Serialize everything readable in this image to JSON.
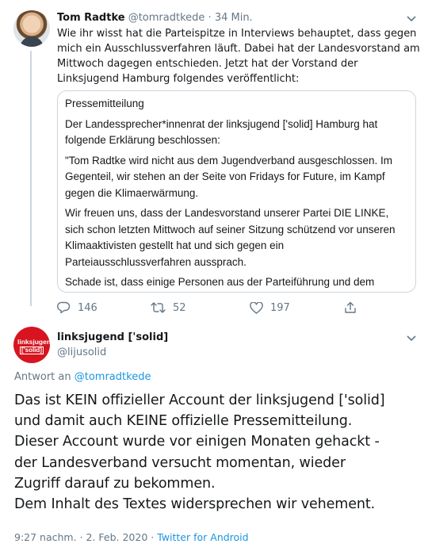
{
  "tweet1": {
    "author_name": "Tom Radtke",
    "author_handle": "@tomradtkede",
    "separator": "·",
    "time": "34 Min.",
    "text": "Wie ihr wisst hat die Parteispitze in Interviews behauptet, dass gegen mich ein Ausschlussverfahren läuft. Dabei hat der Landesvorstand am Mittwoch dagegen entschieden. Jetzt hat der Vorstand der Linksjugend Hamburg folgendes veröffentlicht:",
    "quote": {
      "title": "Pressemitteilung",
      "paragraphs": [
        "Der Landessprecher*innenrat der linksjugend ['solid] Hamburg hat folgende Erklärung beschlossen:",
        "\"Tom Radtke wird nicht aus dem Jugendverband ausgeschlossen. Im Gegenteil, wir stehen an der Seite von Fridays for Future, im Kampf gegen die Klimaerwärmung.",
        "Wir freuen uns, dass der Landesvorstand unserer Partei DIE LINKE, sich schon letzten Mittwoch auf seiner Sitzung schützend vor unseren Klimaaktivisten gestellt hat und sich gegen ein Parteiausschlussverfahren aussprach.",
        "Schade ist, dass einige Personen aus der Parteiführung und dem Pressestab diesen Beschluss ignorierten und in der Presse"
      ]
    },
    "replies": "146",
    "retweets": "52",
    "likes": "197",
    "icons": [
      "reply-icon",
      "retweet-icon",
      "like-icon",
      "share-icon",
      "chevron-down-icon"
    ]
  },
  "tweet2": {
    "author_name": "linksjugend ['solid]",
    "author_handle": "@lijusolid",
    "avatar_logo_top": "linksjugend",
    "avatar_logo_bottom": "['solid]",
    "reply_prefix": "Antwort an",
    "reply_to": "@tomradtkede",
    "lines": [
      "Das ist KEIN offizieller Account der linksjugend ['solid]",
      "und damit auch KEINE offizielle Pressemitteilung.",
      "Dieser Account wurde vor einigen Monaten gehackt -",
      "der Landesverband versucht momentan, wieder",
      "Zugriff darauf zu bekommen.",
      "Dem Inhalt des Textes widersprechen wir vehement."
    ],
    "timestamp": "9:27 nachm. · 2. Feb. 2020",
    "footer_separator": "·",
    "source": "Twitter for Android"
  },
  "colors": {
    "text": "#14171a",
    "secondary": "#657786",
    "link": "#1b95e0",
    "border": "#ccd6dd",
    "brand_red": "#d7141f"
  }
}
